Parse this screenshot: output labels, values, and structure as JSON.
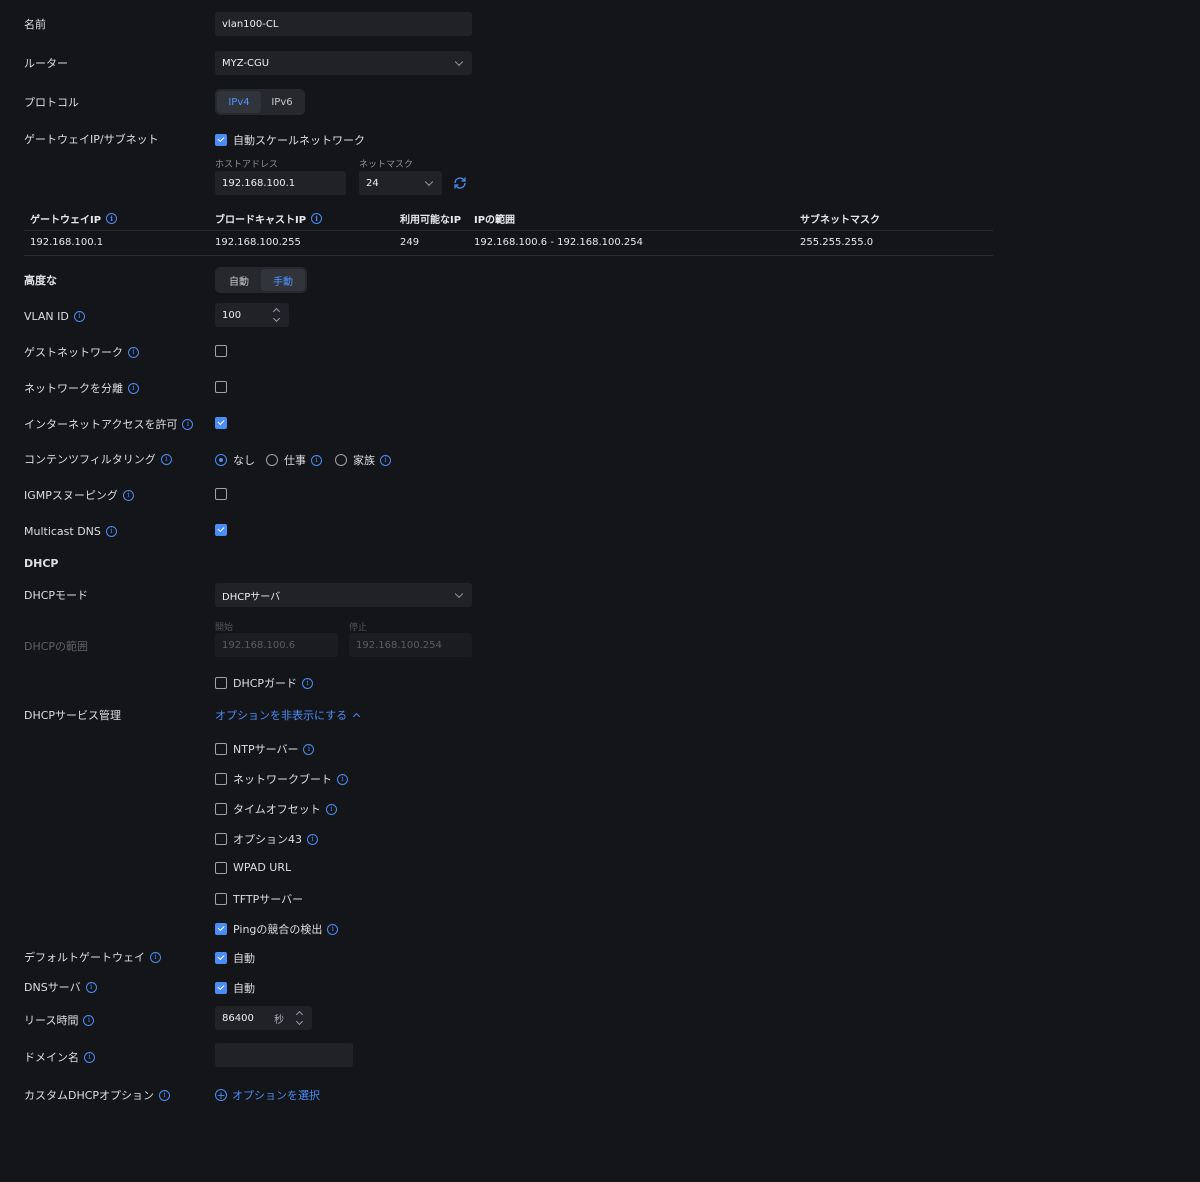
{
  "labels": {
    "name": "名前",
    "router": "ルーター",
    "protocol": "プロトコル",
    "gateway_subnet": "ゲートウェイIP/サブネット",
    "advanced": "高度な",
    "vlan_id": "VLAN ID",
    "guest_network": "ゲストネットワーク",
    "isolate_network": "ネットワークを分離",
    "allow_internet": "インターネットアクセスを許可",
    "content_filtering": "コンテンツフィルタリング",
    "igmp_snooping": "IGMPスヌーピング",
    "multicast_dns": "Multicast DNS",
    "dhcp_section": "DHCP",
    "dhcp_mode": "DHCPモード",
    "dhcp_range": "DHCPの範囲",
    "dhcp_service": "DHCPサービス管理",
    "default_gateway": "デフォルトゲートウェイ",
    "dns_server": "DNSサーバ",
    "lease_time": "リース時間",
    "domain_name": "ドメイン名",
    "custom_dhcp": "カスタムDHCPオプション"
  },
  "fields": {
    "name_value": "vlan100-CL",
    "router_value": "MYZ-CGU",
    "host_address_label": "ホストアドレス",
    "host_address_value": "192.168.100.1",
    "netmask_label": "ネットマスク",
    "netmask_value": "24",
    "vlan_value": "100",
    "dhcp_mode_value": "DHCPサーバ",
    "range_start_label": "開始",
    "range_start_value": "192.168.100.6",
    "range_stop_label": "停止",
    "range_stop_value": "192.168.100.254",
    "lease_value": "86400",
    "lease_unit": "秒",
    "domain_value": ""
  },
  "protocol": {
    "options": [
      "IPv4",
      "IPv6"
    ],
    "selected": "IPv4"
  },
  "advanced": {
    "options": [
      "自動",
      "手動"
    ],
    "selected": "手動"
  },
  "auto_scale": {
    "label": "自動スケールネットワーク",
    "checked": true
  },
  "subnet_table": {
    "headers": [
      "ゲートウェイIP",
      "ブロードキャストIP",
      "利用可能なIP",
      "IPの範囲",
      "サブネットマスク"
    ],
    "row": [
      "192.168.100.1",
      "192.168.100.255",
      "249",
      "192.168.100.6 - 192.168.100.254",
      "255.255.255.0"
    ]
  },
  "checks": {
    "guest_network": false,
    "isolate_network": false,
    "allow_internet": true,
    "igmp_snooping": false,
    "multicast_dns": true
  },
  "content_filter": {
    "options": [
      "なし",
      "仕事",
      "家族"
    ],
    "selected": "なし"
  },
  "dhcp_guard": {
    "label": "DHCPガード",
    "checked": false
  },
  "hide_options_link": "オプションを非表示にする",
  "dhcp_options": [
    {
      "label": "NTPサーバー",
      "checked": false,
      "info": true
    },
    {
      "label": "ネットワークブート",
      "checked": false,
      "info": true
    },
    {
      "label": "タイムオフセット",
      "checked": false,
      "info": true
    },
    {
      "label": "オプション43",
      "checked": false,
      "info": true
    },
    {
      "label": "WPAD URL",
      "checked": false,
      "info": false
    },
    {
      "label": "TFTPサーバー",
      "checked": false,
      "info": false
    },
    {
      "label": "Pingの競合の検出",
      "checked": true,
      "info": true
    }
  ],
  "default_gateway": {
    "label": "自動",
    "checked": true
  },
  "dns_server": {
    "label": "自動",
    "checked": true
  },
  "select_option_link": "オプションを選択",
  "colors": {
    "accent": "#4a8df7",
    "background": "#141519",
    "field": "#202227"
  }
}
